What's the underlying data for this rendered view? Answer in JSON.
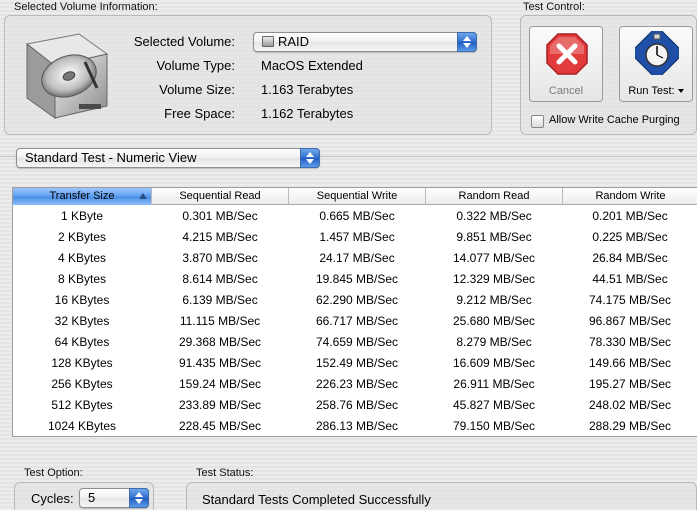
{
  "volume_info": {
    "group_label": "Selected Volume Information:",
    "selected_volume_label": "Selected Volume:",
    "selected_volume_value": "RAID",
    "volume_type_label": "Volume Type:",
    "volume_type_value": "MacOS Extended",
    "volume_size_label": "Volume Size:",
    "volume_size_value": "1.163 Terabytes",
    "free_space_label": "Free Space:",
    "free_space_value": "1.162 Terabytes"
  },
  "test_control": {
    "group_label": "Test Control:",
    "cancel_label": "Cancel",
    "run_test_label": "Run Test:",
    "allow_write_cache_label": "Allow Write Cache Purging",
    "allow_write_cache_checked": false
  },
  "view_selector": {
    "value": "Standard Test - Numeric View"
  },
  "results_table": {
    "columns": [
      "Transfer Size",
      "Sequential Read",
      "Sequential Write",
      "Random Read",
      "Random Write"
    ],
    "rows": [
      [
        "1 KByte",
        "0.301 MB/Sec",
        "0.665 MB/Sec",
        "0.322 MB/Sec",
        "0.201 MB/Sec"
      ],
      [
        "2 KBytes",
        "4.215 MB/Sec",
        "1.457 MB/Sec",
        "9.851 MB/Sec",
        "0.225 MB/Sec"
      ],
      [
        "4 KBytes",
        "3.870 MB/Sec",
        "24.17 MB/Sec",
        "14.077 MB/Sec",
        "26.84 MB/Sec"
      ],
      [
        "8 KBytes",
        "8.614 MB/Sec",
        "19.845 MB/Sec",
        "12.329 MB/Sec",
        "44.51 MB/Sec"
      ],
      [
        "16 KBytes",
        "6.139 MB/Sec",
        "62.290 MB/Sec",
        "9.212 MB/Sec",
        "74.175 MB/Sec"
      ],
      [
        "32 KBytes",
        "11.115 MB/Sec",
        "66.717 MB/Sec",
        "25.680 MB/Sec",
        "96.867 MB/Sec"
      ],
      [
        "64 KBytes",
        "29.368 MB/Sec",
        "74.659 MB/Sec",
        "8.279 MB/Sec",
        "78.330 MB/Sec"
      ],
      [
        "128 KBytes",
        "91.435 MB/Sec",
        "152.49 MB/Sec",
        "16.609 MB/Sec",
        "149.66 MB/Sec"
      ],
      [
        "256 KBytes",
        "159.24 MB/Sec",
        "226.23 MB/Sec",
        "26.911 MB/Sec",
        "195.27 MB/Sec"
      ],
      [
        "512 KBytes",
        "233.89 MB/Sec",
        "258.76 MB/Sec",
        "45.827 MB/Sec",
        "248.02 MB/Sec"
      ],
      [
        "1024 KBytes",
        "228.45 MB/Sec",
        "286.13 MB/Sec",
        "79.150 MB/Sec",
        "288.29 MB/Sec"
      ]
    ]
  },
  "test_option": {
    "group_label": "Test Option:",
    "cycles_label": "Cycles:",
    "cycles_value": "5"
  },
  "test_status": {
    "group_label": "Test Status:",
    "message": "Standard Tests Completed Successfully"
  },
  "colors": {
    "accent_blue": "#2f6fd0",
    "cancel_red": "#e23b3b"
  }
}
